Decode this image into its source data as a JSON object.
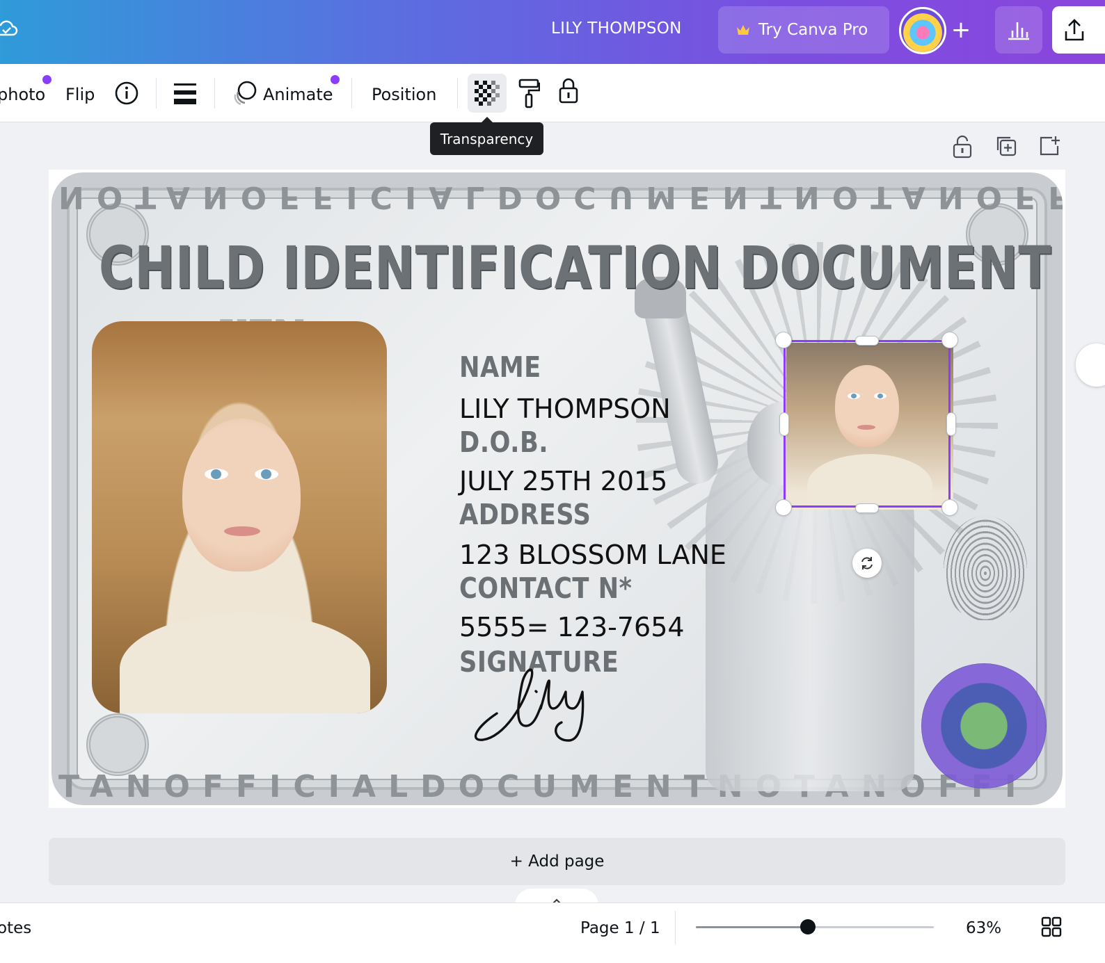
{
  "header": {
    "title": "LILY THOMPSON",
    "pro_button": "Try Canva Pro",
    "plus_label": "+"
  },
  "toolbar": {
    "edit_photo_partial": "photo",
    "flip": "Flip",
    "animate": "Animate",
    "position": "Position",
    "tooltip": "Transparency"
  },
  "card": {
    "heading": "CHILD IDENTIFICATION DOCUMENT",
    "top_strip": "NOTANOFFICIALDOCUMENTNOTANOFFICIALDOCUMENTNOT",
    "bottom_strip": "TANOFFICIALDOCUMENTNOTANOFFI",
    "watermark": "KEN",
    "fields": [
      {
        "label": "NAME",
        "value": "LILY THOMPSON"
      },
      {
        "label": "D.O.B.",
        "value": "JULY 25TH 2015"
      },
      {
        "label": "ADDRESS",
        "value": "123 BLOSSOM LANE"
      },
      {
        "label": "CONTACT N*",
        "value": " 5555= 123-7654"
      },
      {
        "label": "SIGNATURE",
        "value": ""
      }
    ],
    "signature_text": "Lily"
  },
  "add_page": "+ Add page",
  "footer": {
    "notes": "otes",
    "page_indicator": "Page 1 / 1",
    "zoom": "63%",
    "zoom_fraction": 0.47
  },
  "colors": {
    "accent": "#8b3dff",
    "header_gradient_start": "#2f9bd9",
    "header_gradient_end": "#8a45dc"
  }
}
